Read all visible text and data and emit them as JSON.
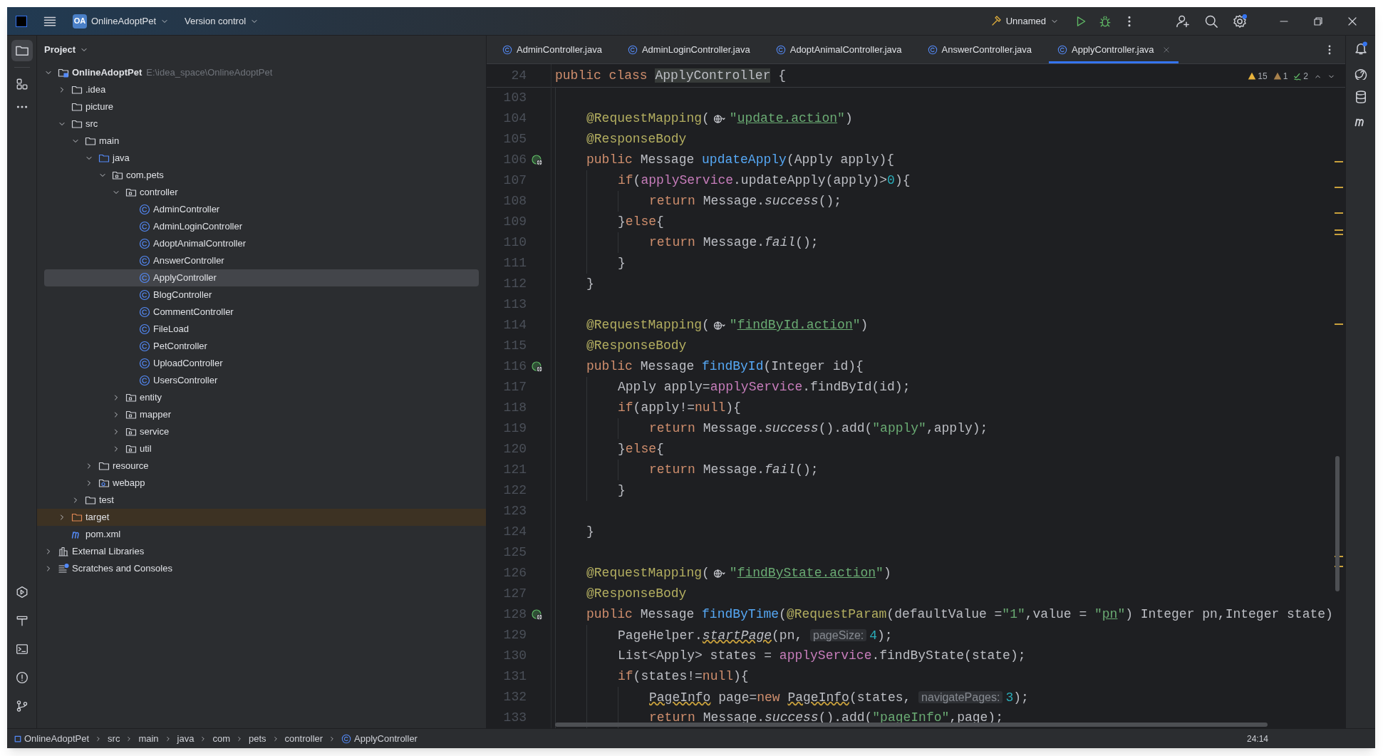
{
  "title_bar": {
    "project_badge": "OA",
    "project_name": "OnlineAdoptPet",
    "vcs": "Version control",
    "run_config": "Unnamed"
  },
  "project_panel": {
    "title": "Project",
    "tree": [
      {
        "label": "OnlineAdoptPet",
        "path": "E:\\idea_space\\OnlineAdoptPet",
        "kind": "module",
        "expanded": true,
        "selected": false,
        "children": [
          {
            "label": ".idea",
            "kind": "folder",
            "expanded": false,
            "selected": false
          },
          {
            "label": "picture",
            "kind": "folder",
            "selected": false
          },
          {
            "label": "src",
            "kind": "folder",
            "expanded": true,
            "selected": false,
            "children": [
              {
                "label": "main",
                "kind": "folder",
                "expanded": true,
                "selected": false,
                "children": [
                  {
                    "label": "java",
                    "kind": "source-folder",
                    "expanded": true,
                    "selected": false,
                    "children": [
                      {
                        "label": "com.pets",
                        "kind": "package",
                        "expanded": true,
                        "selected": false,
                        "children": [
                          {
                            "label": "controller",
                            "kind": "package",
                            "expanded": true,
                            "selected": false,
                            "children": [
                              {
                                "label": "AdminController",
                                "kind": "class",
                                "selected": false
                              },
                              {
                                "label": "AdminLoginController",
                                "kind": "class",
                                "selected": false
                              },
                              {
                                "label": "AdoptAnimalController",
                                "kind": "class",
                                "selected": false
                              },
                              {
                                "label": "AnswerController",
                                "kind": "class",
                                "selected": false
                              },
                              {
                                "label": "ApplyController",
                                "kind": "class",
                                "selected": true
                              },
                              {
                                "label": "BlogController",
                                "kind": "class",
                                "selected": false
                              },
                              {
                                "label": "CommentController",
                                "kind": "class",
                                "selected": false
                              },
                              {
                                "label": "FileLoad",
                                "kind": "class",
                                "selected": false
                              },
                              {
                                "label": "PetController",
                                "kind": "class",
                                "selected": false
                              },
                              {
                                "label": "UploadController",
                                "kind": "class",
                                "selected": false
                              },
                              {
                                "label": "UsersController",
                                "kind": "class",
                                "selected": false
                              }
                            ]
                          },
                          {
                            "label": "entity",
                            "kind": "package",
                            "expanded": false,
                            "selected": false
                          },
                          {
                            "label": "mapper",
                            "kind": "package",
                            "expanded": false,
                            "selected": false
                          },
                          {
                            "label": "service",
                            "kind": "package",
                            "expanded": false,
                            "selected": false
                          },
                          {
                            "label": "util",
                            "kind": "package",
                            "expanded": false,
                            "selected": false
                          }
                        ]
                      }
                    ]
                  },
                  {
                    "label": "resource",
                    "kind": "folder",
                    "expanded": false,
                    "selected": false
                  },
                  {
                    "label": "webapp",
                    "kind": "web-folder",
                    "expanded": false,
                    "selected": false
                  }
                ]
              },
              {
                "label": "test",
                "kind": "folder",
                "expanded": false,
                "selected": false
              }
            ]
          },
          {
            "label": "target",
            "kind": "excluded-folder",
            "expanded": false,
            "selected": false
          },
          {
            "label": "pom.xml",
            "kind": "maven",
            "selected": false
          }
        ]
      },
      {
        "label": "External Libraries",
        "kind": "library",
        "expanded": false,
        "selected": false
      },
      {
        "label": "Scratches and Consoles",
        "kind": "scratches",
        "expanded": false,
        "selected": false
      }
    ]
  },
  "tabs": [
    {
      "label": "AdminController.java",
      "selected": false
    },
    {
      "label": "AdminLoginController.java",
      "selected": false
    },
    {
      "label": "AdoptAnimalController.java",
      "selected": false
    },
    {
      "label": "AnswerController.java",
      "selected": false
    },
    {
      "label": "ApplyController.java",
      "selected": true
    }
  ],
  "inspections": {
    "warnings": "15",
    "weak_warnings": "1",
    "typos": "2"
  },
  "sticky_line": {
    "number": "24",
    "tokens": [
      {
        "kind": "kw",
        "text": "public class "
      },
      {
        "kind": "match",
        "text": "ApplyController"
      },
      {
        "kind": "plain",
        "text": " {"
      }
    ]
  },
  "code": [
    {
      "number": "103",
      "gutter_icon": false
    },
    {
      "number": "104",
      "gutter_icon": false,
      "tokens": [
        {
          "kind": "ann",
          "text": "    @RequestMapping"
        },
        {
          "kind": "plain",
          "text": "("
        },
        {
          "kind": "globe"
        },
        {
          "kind": "str",
          "text": "\""
        },
        {
          "kind": "url",
          "text": "update.action"
        },
        {
          "kind": "str",
          "text": "\""
        },
        {
          "kind": "plain",
          "text": ")"
        }
      ]
    },
    {
      "number": "105",
      "gutter_icon": false,
      "tokens": [
        {
          "kind": "ann",
          "text": "    @ResponseBody"
        }
      ]
    },
    {
      "number": "106",
      "gutter_icon": true,
      "tokens": [
        {
          "kind": "kw",
          "text": "    public "
        },
        {
          "kind": "plain",
          "text": "Message "
        },
        {
          "kind": "fn",
          "text": "updateApply"
        },
        {
          "kind": "plain",
          "text": "(Apply apply){"
        }
      ]
    },
    {
      "number": "107",
      "gutter_icon": false,
      "tokens": [
        {
          "kind": "kw",
          "text": "        if"
        },
        {
          "kind": "plain",
          "text": "("
        },
        {
          "kind": "field",
          "text": "applyService"
        },
        {
          "kind": "plain",
          "text": ".updateApply(apply)>"
        },
        {
          "kind": "num",
          "text": "0"
        },
        {
          "kind": "plain",
          "text": "){"
        }
      ]
    },
    {
      "number": "108",
      "gutter_icon": false,
      "tokens": [
        {
          "kind": "kw",
          "text": "            return "
        },
        {
          "kind": "plain",
          "text": "Message."
        },
        {
          "kind": "italic",
          "text": "success"
        },
        {
          "kind": "plain",
          "text": "();"
        }
      ]
    },
    {
      "number": "109",
      "gutter_icon": false,
      "tokens": [
        {
          "kind": "plain",
          "text": "        }"
        },
        {
          "kind": "kw",
          "text": "else"
        },
        {
          "kind": "plain",
          "text": "{"
        }
      ]
    },
    {
      "number": "110",
      "gutter_icon": false,
      "tokens": [
        {
          "kind": "kw",
          "text": "            return "
        },
        {
          "kind": "plain",
          "text": "Message."
        },
        {
          "kind": "italic",
          "text": "fail"
        },
        {
          "kind": "plain",
          "text": "();"
        }
      ]
    },
    {
      "number": "111",
      "gutter_icon": false,
      "tokens": [
        {
          "kind": "plain",
          "text": "        }"
        }
      ]
    },
    {
      "number": "112",
      "gutter_icon": false,
      "tokens": [
        {
          "kind": "plain",
          "text": "    }"
        }
      ]
    },
    {
      "number": "113",
      "gutter_icon": false
    },
    {
      "number": "114",
      "gutter_icon": false,
      "tokens": [
        {
          "kind": "ann",
          "text": "    @RequestMapping"
        },
        {
          "kind": "plain",
          "text": "("
        },
        {
          "kind": "globe"
        },
        {
          "kind": "str",
          "text": "\""
        },
        {
          "kind": "url",
          "text": "findById.action"
        },
        {
          "kind": "str",
          "text": "\""
        },
        {
          "kind": "plain",
          "text": ")"
        }
      ]
    },
    {
      "number": "115",
      "gutter_icon": false,
      "tokens": [
        {
          "kind": "ann",
          "text": "    @ResponseBody"
        }
      ]
    },
    {
      "number": "116",
      "gutter_icon": true,
      "tokens": [
        {
          "kind": "kw",
          "text": "    public "
        },
        {
          "kind": "plain",
          "text": "Message "
        },
        {
          "kind": "fn",
          "text": "findById"
        },
        {
          "kind": "plain",
          "text": "(Integer id){"
        }
      ]
    },
    {
      "number": "117",
      "gutter_icon": false,
      "tokens": [
        {
          "kind": "plain",
          "text": "        Apply apply="
        },
        {
          "kind": "field",
          "text": "applyService"
        },
        {
          "kind": "plain",
          "text": ".findById(id);"
        }
      ]
    },
    {
      "number": "118",
      "gutter_icon": false,
      "tokens": [
        {
          "kind": "kw",
          "text": "        if"
        },
        {
          "kind": "plain",
          "text": "(apply!="
        },
        {
          "kind": "kw",
          "text": "null"
        },
        {
          "kind": "plain",
          "text": "){"
        }
      ]
    },
    {
      "number": "119",
      "gutter_icon": false,
      "tokens": [
        {
          "kind": "kw",
          "text": "            return "
        },
        {
          "kind": "plain",
          "text": "Message."
        },
        {
          "kind": "italic",
          "text": "success"
        },
        {
          "kind": "plain",
          "text": "().add("
        },
        {
          "kind": "str",
          "text": "\"apply\""
        },
        {
          "kind": "plain",
          "text": ",apply);"
        }
      ]
    },
    {
      "number": "120",
      "gutter_icon": false,
      "tokens": [
        {
          "kind": "plain",
          "text": "        }"
        },
        {
          "kind": "kw",
          "text": "else"
        },
        {
          "kind": "plain",
          "text": "{"
        }
      ]
    },
    {
      "number": "121",
      "gutter_icon": false,
      "tokens": [
        {
          "kind": "kw",
          "text": "            return "
        },
        {
          "kind": "plain",
          "text": "Message."
        },
        {
          "kind": "italic",
          "text": "fail"
        },
        {
          "kind": "plain",
          "text": "();"
        }
      ]
    },
    {
      "number": "122",
      "gutter_icon": false,
      "tokens": [
        {
          "kind": "plain",
          "text": "        }"
        }
      ]
    },
    {
      "number": "123",
      "gutter_icon": false
    },
    {
      "number": "124",
      "gutter_icon": false,
      "tokens": [
        {
          "kind": "plain",
          "text": "    }"
        }
      ]
    },
    {
      "number": "125",
      "gutter_icon": false
    },
    {
      "number": "126",
      "gutter_icon": false,
      "tokens": [
        {
          "kind": "ann",
          "text": "    @RequestMapping"
        },
        {
          "kind": "plain",
          "text": "("
        },
        {
          "kind": "globe"
        },
        {
          "kind": "str",
          "text": "\""
        },
        {
          "kind": "url",
          "text": "findByState.action"
        },
        {
          "kind": "str",
          "text": "\""
        },
        {
          "kind": "plain",
          "text": ")"
        }
      ]
    },
    {
      "number": "127",
      "gutter_icon": false,
      "tokens": [
        {
          "kind": "ann",
          "text": "    @ResponseBody"
        }
      ]
    },
    {
      "number": "128",
      "gutter_icon": true,
      "tokens": [
        {
          "kind": "kw",
          "text": "    public "
        },
        {
          "kind": "plain",
          "text": "Message "
        },
        {
          "kind": "fn",
          "text": "findByTime"
        },
        {
          "kind": "plain",
          "text": "("
        },
        {
          "kind": "ann",
          "text": "@RequestParam"
        },
        {
          "kind": "plain",
          "text": "(defaultValue ="
        },
        {
          "kind": "str",
          "text": "\"1\""
        },
        {
          "kind": "plain",
          "text": ",value = "
        },
        {
          "kind": "str",
          "text": "\""
        },
        {
          "kind": "url",
          "text": "pn"
        },
        {
          "kind": "str",
          "text": "\""
        },
        {
          "kind": "plain",
          "text": ") Integer pn,Integer state)"
        }
      ]
    },
    {
      "number": "129",
      "gutter_icon": false,
      "tokens": [
        {
          "kind": "plain",
          "text": "        PageHelper."
        },
        {
          "kind": "warn-italic",
          "text": "startPage"
        },
        {
          "kind": "plain",
          "text": "(pn, "
        },
        {
          "kind": "hint",
          "text": "pageSize:"
        },
        {
          "kind": "num",
          "text": "4"
        },
        {
          "kind": "plain",
          "text": ");"
        }
      ]
    },
    {
      "number": "130",
      "gutter_icon": false,
      "tokens": [
        {
          "kind": "plain",
          "text": "        List<Apply> states = "
        },
        {
          "kind": "field",
          "text": "applyService"
        },
        {
          "kind": "plain",
          "text": ".findByState(state);"
        }
      ]
    },
    {
      "number": "131",
      "gutter_icon": false,
      "tokens": [
        {
          "kind": "kw",
          "text": "        if"
        },
        {
          "kind": "plain",
          "text": "(states!="
        },
        {
          "kind": "kw",
          "text": "null"
        },
        {
          "kind": "plain",
          "text": "){"
        }
      ]
    },
    {
      "number": "132",
      "gutter_icon": false,
      "tokens": [
        {
          "kind": "warn",
          "text": "            PageInfo"
        },
        {
          "kind": "plain",
          "text": " page="
        },
        {
          "kind": "kw",
          "text": "new "
        },
        {
          "kind": "warn",
          "text": "PageInfo"
        },
        {
          "kind": "plain",
          "text": "(states, "
        },
        {
          "kind": "hint",
          "text": "navigatePages:"
        },
        {
          "kind": "num",
          "text": "3"
        },
        {
          "kind": "plain",
          "text": ");"
        }
      ]
    },
    {
      "number": "133",
      "gutter_icon": false,
      "tokens": [
        {
          "kind": "kw",
          "text": "            return "
        },
        {
          "kind": "plain",
          "text": "Message."
        },
        {
          "kind": "italic",
          "text": "success"
        },
        {
          "kind": "plain",
          "text": "().add("
        },
        {
          "kind": "str",
          "text": "\"pageInfo\""
        },
        {
          "kind": "plain",
          "text": ",page);"
        }
      ]
    }
  ],
  "breadcrumbs": [
    {
      "label": "OnlineAdoptPet",
      "kind": "module"
    },
    {
      "label": "src",
      "kind": "plain"
    },
    {
      "label": "main",
      "kind": "plain"
    },
    {
      "label": "java",
      "kind": "plain"
    },
    {
      "label": "com",
      "kind": "plain"
    },
    {
      "label": "pets",
      "kind": "plain"
    },
    {
      "label": "controller",
      "kind": "plain"
    },
    {
      "label": "ApplyController",
      "kind": "class"
    }
  ],
  "caret_position": "24:14"
}
